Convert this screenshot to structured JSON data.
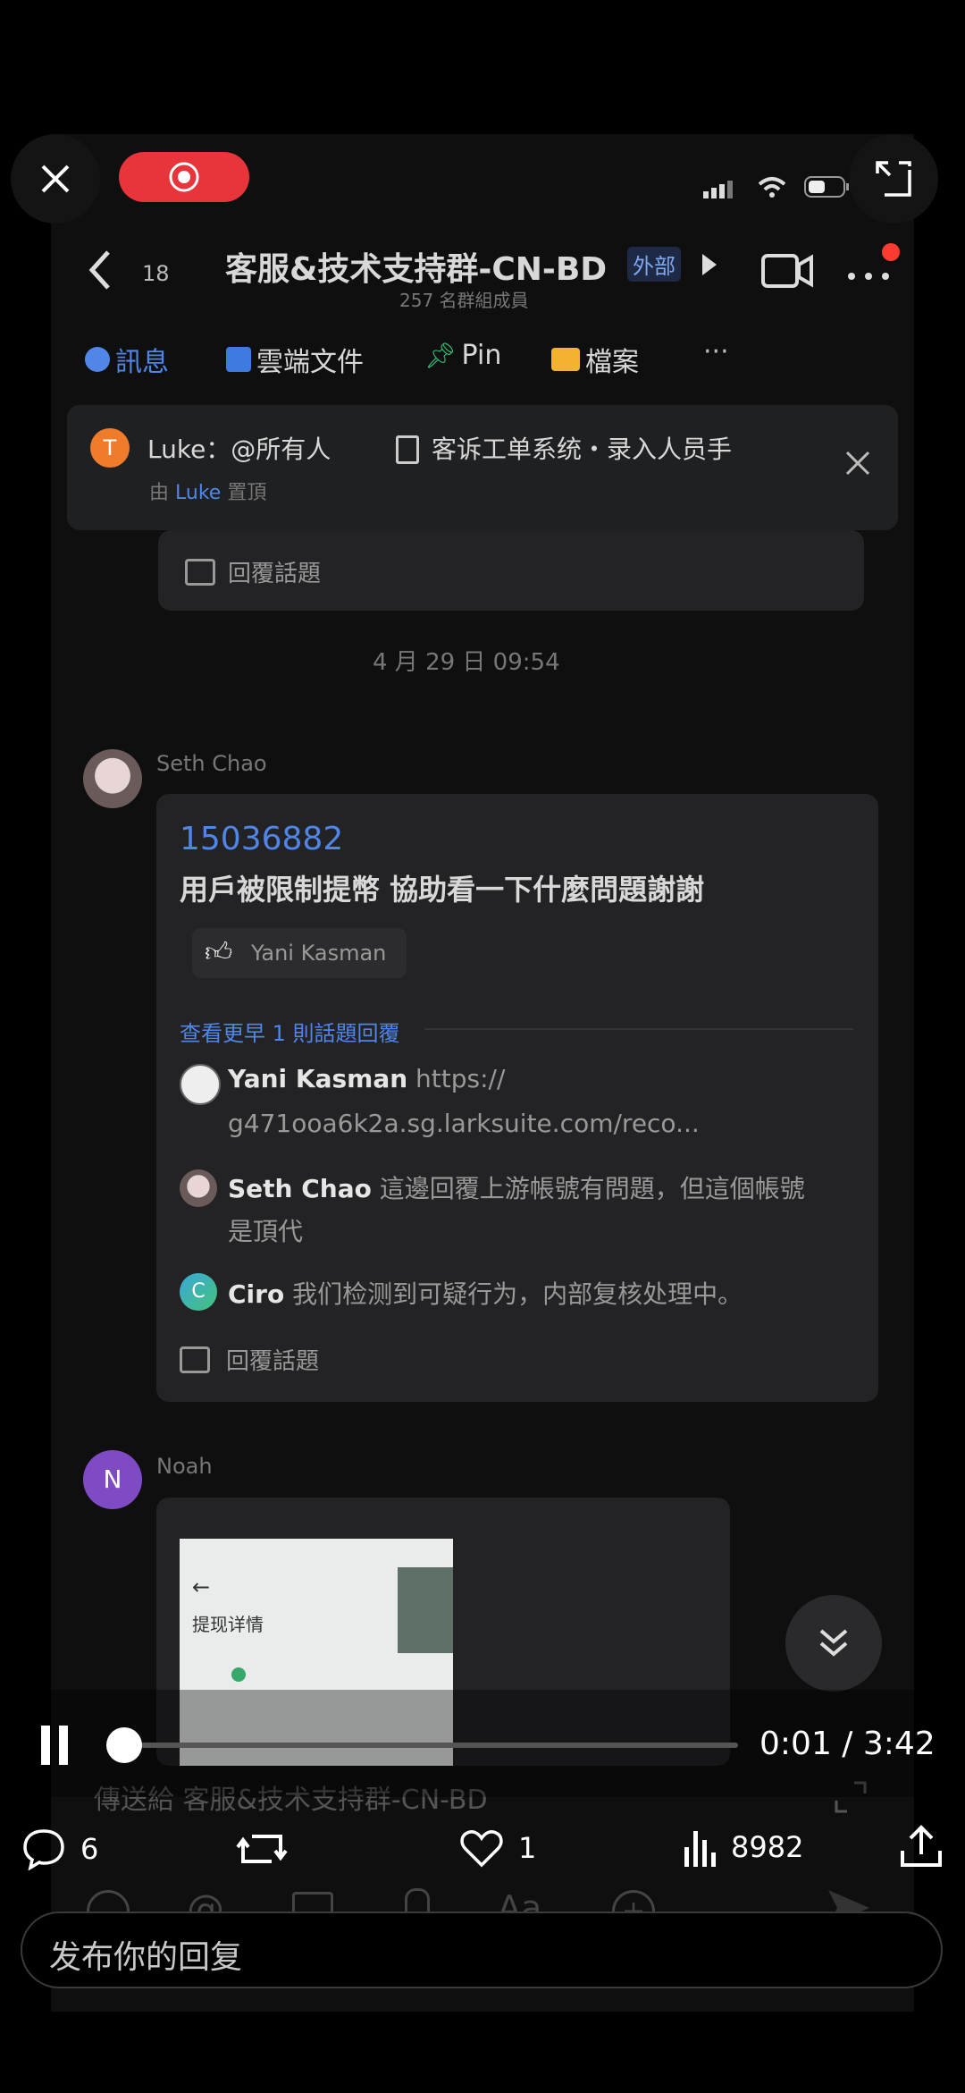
{
  "player": {
    "time_current": "0:01",
    "time_separator": " / ",
    "time_total": "3:42",
    "progress": 0.005
  },
  "chat": {
    "unread_count": "18",
    "group_title": "客服&技术支持群-CN-BD",
    "external_badge": "外部",
    "member_count": "257 名群組成員",
    "tabs": [
      "訊息",
      "雲端文件",
      "Pin",
      "檔案",
      "···"
    ],
    "pinned": {
      "author": "Luke：@所有人",
      "doc_title": "客诉工单系统・录入人员手",
      "by_prefix": "由",
      "by_name": "Luke",
      "by_suffix": "置頂"
    },
    "reply_topic": "回覆話題",
    "date_divider": "4 月 29 日 09:54",
    "thread": {
      "sender": "Seth Chao",
      "id": "15036882",
      "message": "用戶被限制提幣 協助看一下什麼問題謝謝",
      "reaction_user": "Yani Kasman",
      "view_earlier": "查看更早 1 則話題回覆",
      "replies": [
        {
          "name": "Yani Kasman",
          "text": "https://",
          "text2": "g471ooa6k2a.sg.larksuite.com/reco..."
        },
        {
          "name": "Seth Chao",
          "text": "這邊回覆上游帳號有問題，但這個帳號",
          "text2": "是頂代"
        },
        {
          "name": "Ciro",
          "text": "我们检测到可疑行为，内部复核处理中。",
          "initial": "C"
        }
      ],
      "reply_topic": "回覆話題"
    },
    "noah": {
      "sender": "Noah",
      "initial": "N",
      "thumb_title": "提现详情"
    },
    "composer_placeholder": "傳送給 客服&技术支持群-CN-BD"
  },
  "actions": {
    "comments": "6",
    "likes": "1",
    "views": "8982"
  },
  "reply_input": {
    "placeholder": "发布你的回复"
  },
  "colors": {
    "record": "#e8343b",
    "accent_blue": "#4f86e8",
    "badge_red": "#ff3b30"
  }
}
